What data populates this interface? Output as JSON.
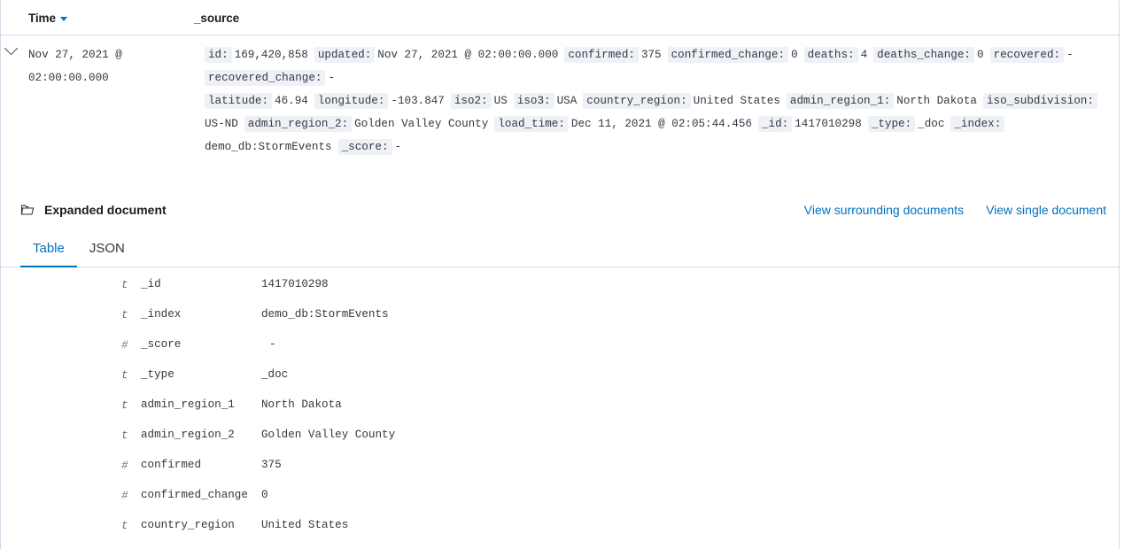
{
  "table": {
    "columns": [
      {
        "label": "Time",
        "sort": "desc",
        "sort_icon": "caret-down-icon"
      },
      {
        "label": "_source"
      }
    ]
  },
  "document_row": {
    "expand_icon": "chevron-down-icon",
    "expanded": true,
    "time": "Nov 27, 2021 @ 02:00:00.000",
    "source_pairs": [
      {
        "key": "id:",
        "value": "169,420,858"
      },
      {
        "key": "updated:",
        "value": "Nov 27, 2021 @ 02:00:00.000"
      },
      {
        "key": "confirmed:",
        "value": "375"
      },
      {
        "key": "confirmed_change:",
        "value": "0"
      },
      {
        "key": "deaths:",
        "value": "4"
      },
      {
        "key": "deaths_change:",
        "value": "0"
      },
      {
        "key": "recovered:",
        "value": "-"
      },
      {
        "key": "recovered_change:",
        "value": "-"
      },
      {
        "key": "latitude:",
        "value": "46.94"
      },
      {
        "key": "longitude:",
        "value": "-103.847"
      },
      {
        "key": "iso2:",
        "value": "US"
      },
      {
        "key": "iso3:",
        "value": "USA"
      },
      {
        "key": "country_region:",
        "value": "United States"
      },
      {
        "key": "admin_region_1:",
        "value": "North Dakota"
      },
      {
        "key": "iso_subdivision:",
        "value": "US-ND"
      },
      {
        "key": "admin_region_2:",
        "value": "Golden Valley County"
      },
      {
        "key": "load_time:",
        "value": "Dec 11, 2021 @ 02:05:44.456"
      },
      {
        "key": "_id:",
        "value": "1417010298"
      },
      {
        "key": "_type:",
        "value": "_doc"
      },
      {
        "key": "_index:",
        "value": "demo_db:StormEvents"
      },
      {
        "key": "_score:",
        "value": "-"
      }
    ]
  },
  "expanded_document": {
    "icon": "folder-open-icon",
    "title": "Expanded document",
    "links": [
      {
        "label": "View surrounding documents"
      },
      {
        "label": "View single document"
      }
    ],
    "tabs": [
      {
        "label": "Table",
        "active": true
      },
      {
        "label": "JSON",
        "active": false
      }
    ],
    "fields": [
      {
        "type": "t",
        "name": "_id",
        "value": "1417010298"
      },
      {
        "type": "t",
        "name": "_index",
        "value": "demo_db:StormEvents"
      },
      {
        "type": "#",
        "name": "_score",
        "value": "-"
      },
      {
        "type": "t",
        "name": "_type",
        "value": "_doc"
      },
      {
        "type": "t",
        "name": "admin_region_1",
        "value": "North Dakota"
      },
      {
        "type": "t",
        "name": "admin_region_2",
        "value": "Golden Valley County"
      },
      {
        "type": "#",
        "name": "confirmed",
        "value": "375"
      },
      {
        "type": "#",
        "name": "confirmed_change",
        "value": "0"
      },
      {
        "type": "t",
        "name": "country_region",
        "value": "United States"
      }
    ]
  },
  "colors": {
    "link": "#0071c2",
    "border": "#d3dae6",
    "pill_bg": "#eef2f7",
    "text": "#343741"
  }
}
